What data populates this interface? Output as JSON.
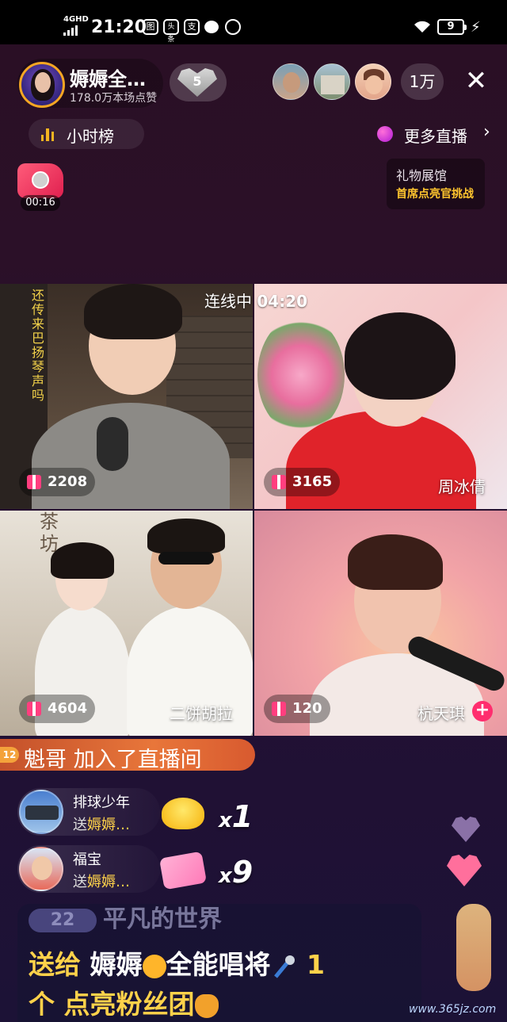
{
  "status_bar": {
    "network": "4GHD",
    "time": "21:20",
    "apps": [
      "图",
      "头条",
      "支",
      "●",
      "◎"
    ],
    "battery": "9"
  },
  "host": {
    "name": "媷媷全…",
    "likes": "178.0万本场点赞",
    "fan_level": "5"
  },
  "viewers": {
    "count": "1万"
  },
  "toolbar": {
    "rank_label": "小时榜",
    "more_live_label": "更多直播",
    "timer": "00:16",
    "gift_hall_title": "礼物展馆",
    "gift_hall_subtitle": "首席点亮官挑战"
  },
  "connection": {
    "label": "连线中",
    "time": "04:20"
  },
  "streams": [
    {
      "score": "2208",
      "name": ""
    },
    {
      "score": "3165",
      "name": "周冰倩"
    },
    {
      "score": "4604",
      "name": "二饼胡拉"
    },
    {
      "score": "120",
      "name": "杭天琪"
    }
  ],
  "join": {
    "level": "12",
    "text": "魁哥  加入了直播间"
  },
  "gifts": [
    {
      "user": "排球少年",
      "send_prefix": "送",
      "target": "媷媷…",
      "count_prefix": "x",
      "count": "1"
    },
    {
      "user": "福宝",
      "send_prefix": "送",
      "target": "媷媷…",
      "count_prefix": "x",
      "count": "9"
    }
  ],
  "ticker": {
    "prev_level": "22",
    "prev_text": "平凡的世界",
    "line1_a": "送给  ",
    "line1_b": "媷媷",
    "line1_c": "全能唱将",
    "line1_d": " 1",
    "line2_a": "个  ",
    "line2_b": "点亮粉丝团"
  },
  "watermark": "www.365jz.com",
  "colors": {
    "accent_gold": "#ffd24a",
    "join_banner": "#e8763a",
    "gift_icon": "#ff3e7f"
  }
}
